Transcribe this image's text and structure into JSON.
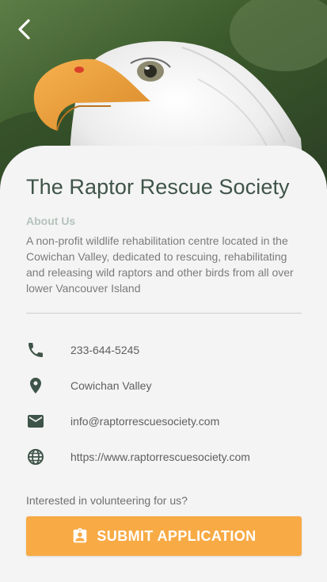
{
  "header": {
    "hero_image": "bald-eagle-photo",
    "back_icon": "chevron-left-icon"
  },
  "organization": {
    "name": "The Raptor Rescue Society"
  },
  "about": {
    "heading": "About Us",
    "description": "A non-profit wildlife rehabilitation centre located in the Cowichan Valley, dedicated to rescuing, rehabilitating and releasing wild raptors and other birds from all over lower Vancouver Island"
  },
  "contact": {
    "phone": {
      "icon": "phone-icon",
      "value": "233-644-5245"
    },
    "location": {
      "icon": "location-pin-icon",
      "value": "Cowichan Valley"
    },
    "email": {
      "icon": "email-icon",
      "value": "info@raptorrescuesociety.com"
    },
    "website": {
      "icon": "globe-icon",
      "value": "https://www.raptorrescuesociety.com"
    }
  },
  "volunteer": {
    "prompt": "Interested in volunteering for us?",
    "button_label": "SUBMIT APPLICATION",
    "button_icon": "badge-icon"
  },
  "colors": {
    "title": "#3f5449",
    "icon": "#3f5449",
    "accent": "#f8aa45",
    "subheading": "#b5c3bc",
    "background": "#f4f4f4"
  }
}
